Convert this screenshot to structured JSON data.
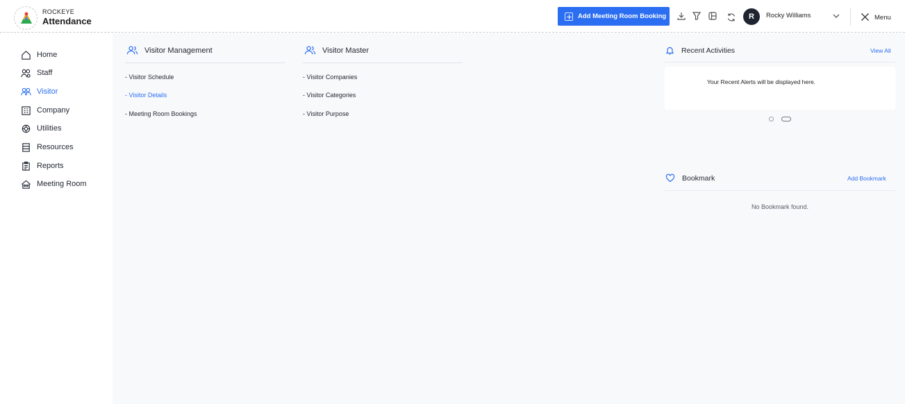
{
  "brand": {
    "top": "ROCKEYE",
    "name": "Attendance"
  },
  "header": {
    "add_button_label": "Add Meeting Room Booking",
    "user_initial": "R",
    "user_name": "Rocky Williams",
    "menu_label": "Menu",
    "icons": [
      "download-icon",
      "filter-icon",
      "layout-icon",
      "refresh-icon",
      "chevron-down-icon",
      "close-icon"
    ]
  },
  "sidebar": {
    "items": [
      {
        "label": "Home",
        "icon": "home-icon",
        "active": false
      },
      {
        "label": "Staff",
        "icon": "staff-icon",
        "active": false
      },
      {
        "label": "Visitor",
        "icon": "visitor-icon",
        "active": true
      },
      {
        "label": "Company",
        "icon": "company-icon",
        "active": false
      },
      {
        "label": "Utilities",
        "icon": "utilities-icon",
        "active": false
      },
      {
        "label": "Resources",
        "icon": "resources-icon",
        "active": false
      },
      {
        "label": "Reports",
        "icon": "reports-icon",
        "active": false
      },
      {
        "label": "Meeting Room",
        "icon": "meeting-room-icon",
        "active": false
      }
    ]
  },
  "visitor_management": {
    "title": "Visitor Management",
    "links": [
      "- Visitor Schedule",
      "- Visitor Details",
      "- Meeting Room Bookings"
    ],
    "active_index": 1
  },
  "visitor_master": {
    "title": "Visitor Master",
    "links": [
      "- Visitor Companies",
      "- Visitor Categories",
      "- Visitor Purpose"
    ]
  },
  "recent_activities": {
    "title": "Recent Activities",
    "action": "View All",
    "message": "Your Recent Alerts will be displayed here."
  },
  "bookmark": {
    "title": "Bookmark",
    "action": "Add Bookmark",
    "empty": "No Bookmark found."
  },
  "colors": {
    "accent": "#2b6ef2",
    "dark": "#1f2430",
    "main_bg": "#f8f9fb"
  }
}
